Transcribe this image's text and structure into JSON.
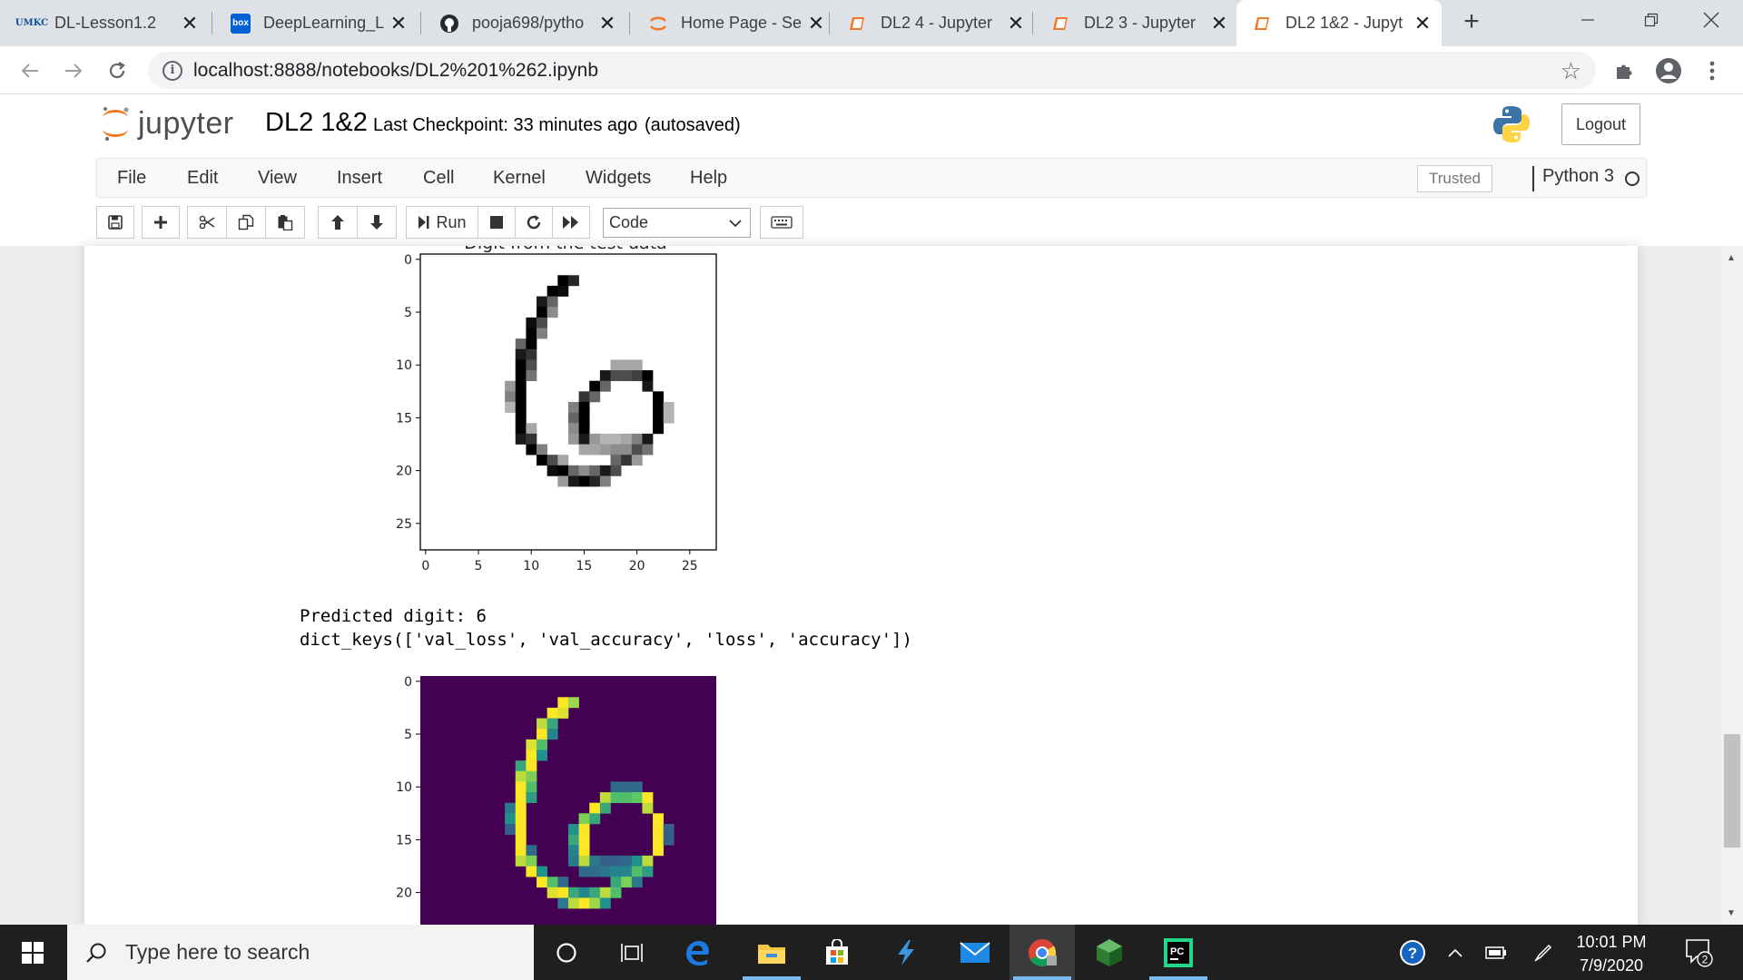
{
  "browser": {
    "tabs": [
      {
        "title": "DL-Lesson1.2",
        "favicon": "umkc-icon"
      },
      {
        "title": "DeepLearning_L",
        "favicon": "box-icon"
      },
      {
        "title": "pooja698/pytho",
        "favicon": "github-icon"
      },
      {
        "title": "Home Page - Se",
        "favicon": "jupyter-icon"
      },
      {
        "title": "DL2 4 - Jupyter",
        "favicon": "notebook-icon"
      },
      {
        "title": "DL2 3 - Jupyter",
        "favicon": "notebook-icon"
      },
      {
        "title": "DL2 1&2 - Jupyt",
        "favicon": "notebook-icon"
      }
    ],
    "favicon_text": {
      "umkc": "UMKC",
      "box": "box"
    },
    "url": "localhost:8888/notebooks/DL2%201%262.ipynb"
  },
  "jupyter": {
    "logo_text": "jupyter",
    "notebook_name": "DL2 1&2",
    "checkpoint": "Last Checkpoint: 33 minutes ago",
    "autosave": "(autosaved)",
    "logout_label": "Logout",
    "menu": [
      "File",
      "Edit",
      "View",
      "Insert",
      "Cell",
      "Kernel",
      "Widgets",
      "Help"
    ],
    "trusted_label": "Trusted",
    "kernel_name": "Python 3",
    "toolbar": {
      "run_label": "Run",
      "cell_type": "Code"
    }
  },
  "outputs": {
    "plot1": {
      "title": "Digit from the test data",
      "colormap": "gray_r",
      "y_ticks": [
        "0",
        "5",
        "10",
        "15",
        "20",
        "25"
      ],
      "x_ticks": [
        "0",
        "5",
        "10",
        "15",
        "20",
        "25"
      ]
    },
    "text_lines": [
      "Predicted digit: 6",
      "dict_keys(['val_loss', 'val_accuracy', 'loss', 'accuracy'])"
    ],
    "plot2": {
      "colormap": "viridis",
      "y_ticks": [
        "0",
        "5",
        "10",
        "15",
        "20"
      ]
    },
    "digit_pixels": [
      [
        2,
        13,
        1.0
      ],
      [
        2,
        14,
        0.85
      ],
      [
        3,
        12,
        1.0
      ],
      [
        3,
        13,
        0.95
      ],
      [
        4,
        11,
        0.9
      ],
      [
        4,
        12,
        0.6
      ],
      [
        5,
        11,
        1.0
      ],
      [
        5,
        12,
        0.45
      ],
      [
        6,
        10,
        0.95
      ],
      [
        6,
        11,
        0.7
      ],
      [
        7,
        10,
        1.0
      ],
      [
        7,
        11,
        0.5
      ],
      [
        8,
        9,
        0.6
      ],
      [
        8,
        10,
        1.0
      ],
      [
        9,
        9,
        0.9
      ],
      [
        9,
        10,
        0.8
      ],
      [
        10,
        9,
        1.0
      ],
      [
        10,
        10,
        0.7
      ],
      [
        10,
        18,
        0.35
      ],
      [
        10,
        19,
        0.35
      ],
      [
        10,
        20,
        0.35
      ],
      [
        11,
        9,
        1.0
      ],
      [
        11,
        10,
        0.55
      ],
      [
        11,
        17,
        0.9
      ],
      [
        11,
        18,
        0.7
      ],
      [
        11,
        19,
        0.7
      ],
      [
        11,
        20,
        0.75
      ],
      [
        11,
        21,
        1.0
      ],
      [
        12,
        8,
        0.4
      ],
      [
        12,
        9,
        1.0
      ],
      [
        12,
        16,
        1.0
      ],
      [
        12,
        17,
        0.6
      ],
      [
        12,
        21,
        0.9
      ],
      [
        13,
        8,
        0.5
      ],
      [
        13,
        9,
        1.0
      ],
      [
        13,
        15,
        0.8
      ],
      [
        13,
        16,
        0.6
      ],
      [
        13,
        22,
        1.0
      ],
      [
        14,
        8,
        0.3
      ],
      [
        14,
        9,
        1.0
      ],
      [
        14,
        14,
        0.5
      ],
      [
        14,
        15,
        1.0
      ],
      [
        14,
        22,
        1.0
      ],
      [
        14,
        23,
        0.3
      ],
      [
        15,
        9,
        1.0
      ],
      [
        15,
        14,
        0.6
      ],
      [
        15,
        15,
        1.0
      ],
      [
        15,
        22,
        1.0
      ],
      [
        15,
        23,
        0.3
      ],
      [
        16,
        9,
        1.0
      ],
      [
        16,
        10,
        0.35
      ],
      [
        16,
        14,
        0.45
      ],
      [
        16,
        15,
        1.0
      ],
      [
        16,
        22,
        1.0
      ],
      [
        17,
        9,
        0.9
      ],
      [
        17,
        10,
        0.8
      ],
      [
        17,
        14,
        0.4
      ],
      [
        17,
        15,
        0.9
      ],
      [
        17,
        16,
        0.4
      ],
      [
        17,
        17,
        0.3
      ],
      [
        17,
        18,
        0.3
      ],
      [
        17,
        19,
        0.35
      ],
      [
        17,
        20,
        0.5
      ],
      [
        17,
        21,
        0.9
      ],
      [
        18,
        10,
        1.0
      ],
      [
        18,
        11,
        0.5
      ],
      [
        18,
        15,
        0.35
      ],
      [
        18,
        16,
        0.35
      ],
      [
        18,
        17,
        0.4
      ],
      [
        18,
        18,
        0.45
      ],
      [
        18,
        19,
        0.45
      ],
      [
        18,
        20,
        0.7
      ],
      [
        18,
        21,
        0.55
      ],
      [
        19,
        11,
        1.0
      ],
      [
        19,
        12,
        0.7
      ],
      [
        19,
        13,
        0.35
      ],
      [
        19,
        18,
        0.6
      ],
      [
        19,
        19,
        0.8
      ],
      [
        19,
        20,
        0.4
      ],
      [
        20,
        12,
        0.95
      ],
      [
        20,
        13,
        1.0
      ],
      [
        20,
        14,
        0.6
      ],
      [
        20,
        15,
        0.45
      ],
      [
        20,
        16,
        0.6
      ],
      [
        20,
        17,
        0.9
      ],
      [
        20,
        18,
        0.7
      ],
      [
        21,
        13,
        0.4
      ],
      [
        21,
        14,
        0.9
      ],
      [
        21,
        15,
        1.0
      ],
      [
        21,
        16,
        0.85
      ],
      [
        21,
        17,
        0.5
      ]
    ]
  },
  "taskbar": {
    "search_placeholder": "Type here to search",
    "time": "10:01 PM",
    "date": "7/9/2020",
    "notification_count": "2",
    "pycharm_label": "PC"
  }
}
